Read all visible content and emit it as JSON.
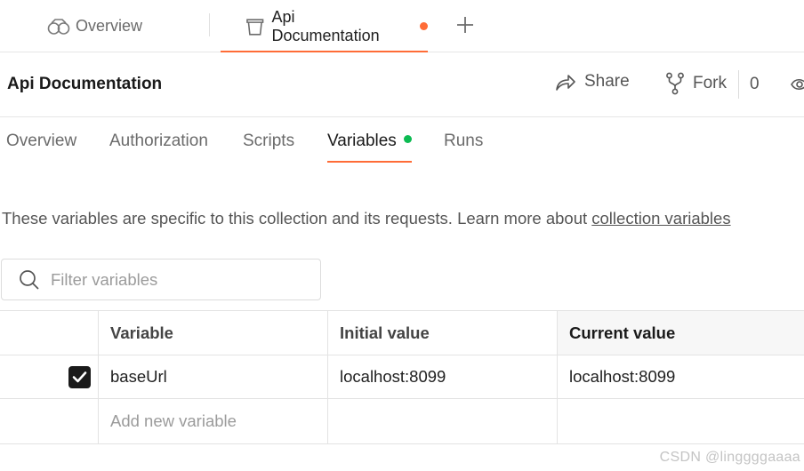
{
  "tabs": {
    "overview_label": "Overview",
    "active_label": "Api Documentation"
  },
  "header": {
    "title": "Api Documentation",
    "share_label": "Share",
    "fork_label": "Fork",
    "fork_count": "0"
  },
  "subtabs": {
    "overview": "Overview",
    "authorization": "Authorization",
    "scripts": "Scripts",
    "variables": "Variables",
    "runs": "Runs"
  },
  "description": {
    "text": "These variables are specific to this collection and its requests. Learn more about ",
    "link": "collection variables"
  },
  "filter": {
    "placeholder": "Filter variables"
  },
  "table": {
    "headers": [
      "Variable",
      "Initial value",
      "Current value"
    ],
    "rows": [
      {
        "checked": true,
        "variable": "baseUrl",
        "initial": "localhost:8099",
        "current": "localhost:8099"
      }
    ],
    "add_placeholder": "Add new variable"
  },
  "watermark": "CSDN @linggggaaaa",
  "colors": {
    "accent": "#ff6c37",
    "status_green": "#0cbb52"
  }
}
